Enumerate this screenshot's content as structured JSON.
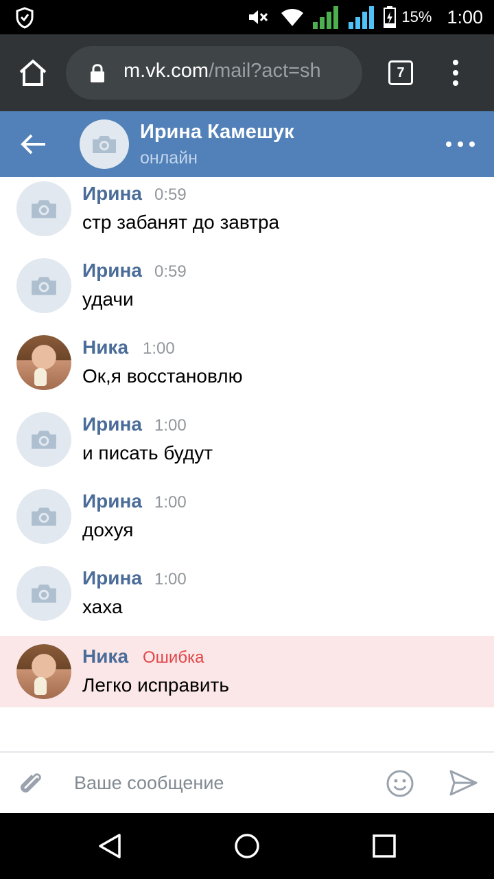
{
  "status_bar": {
    "battery_percent": "15%",
    "time": "1:00",
    "icons": [
      "shield-icon",
      "mute-icon",
      "wifi-icon",
      "signal-icon",
      "signal-icon",
      "battery-icon"
    ]
  },
  "browser": {
    "url_host": "m.vk.com",
    "url_path": "/mail?act=sh",
    "tab_count": "7"
  },
  "chat_header": {
    "name": "Ирина Камешук",
    "status": "онлайн"
  },
  "messages": [
    {
      "author": "Ирина",
      "time": "0:59",
      "text": "стр забанят до завтра",
      "avatar": "camera"
    },
    {
      "author": "Ирина",
      "time": "0:59",
      "text": "удачи",
      "avatar": "camera"
    },
    {
      "author": "Ника",
      "time": "1:00",
      "text": "Ок,я восстановлю",
      "avatar": "photo"
    },
    {
      "author": "Ирина",
      "time": "1:00",
      "text": "и писать будут",
      "avatar": "camera"
    },
    {
      "author": "Ирина",
      "time": "1:00",
      "text": "дохуя",
      "avatar": "camera"
    },
    {
      "author": "Ирина",
      "time": "1:00",
      "text": "хаха",
      "avatar": "camera"
    },
    {
      "author": "Ника",
      "error": "Ошибка",
      "text": "Легко исправить",
      "avatar": "photo"
    }
  ],
  "composer": {
    "placeholder": "Ваше сообщение",
    "value": ""
  },
  "colors": {
    "header_bg": "#5181b8",
    "name_color": "#4a6c99",
    "error_bg": "#fbe7e7",
    "error_text": "#e0474a"
  }
}
